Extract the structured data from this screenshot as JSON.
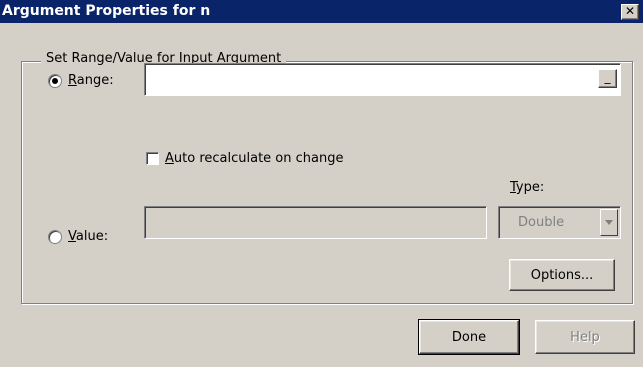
{
  "window": {
    "title": "Argument Properties for n",
    "close_glyph": "✕"
  },
  "group": {
    "label": "Set Range/Value for Input Argument"
  },
  "range": {
    "mnemonic": "R",
    "rest": "ange:",
    "selected": true,
    "value": "",
    "picker_glyph": "_"
  },
  "auto_recalc": {
    "mnemonic": "A",
    "rest": "uto recalculate on change",
    "checked": false
  },
  "value": {
    "mnemonic": "V",
    "rest": "alue:",
    "selected": false,
    "value": ""
  },
  "type": {
    "mnemonic": "T",
    "rest": "ype:",
    "selected_option": "Double"
  },
  "buttons": {
    "options": "Options...",
    "done": "Done",
    "help": "Help"
  }
}
